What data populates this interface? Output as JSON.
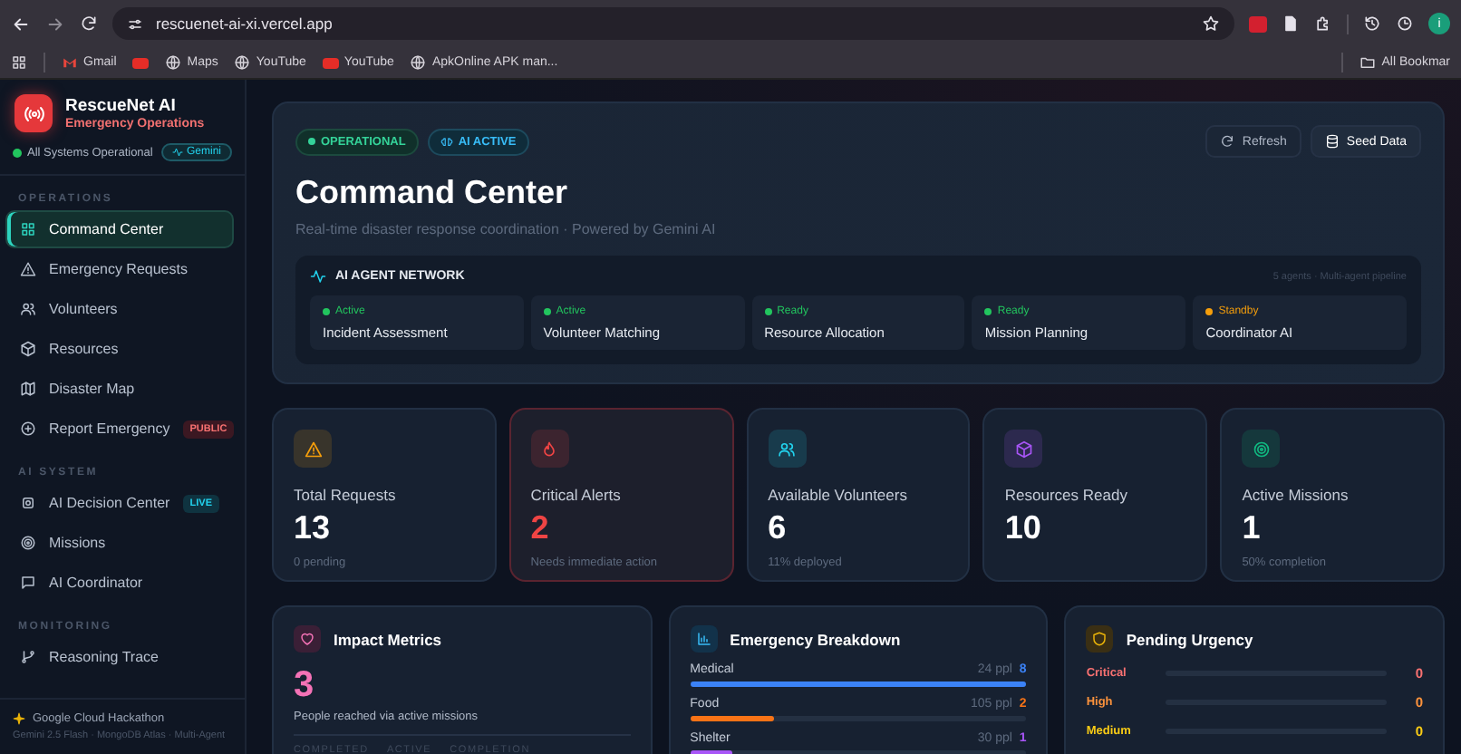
{
  "browser": {
    "url": "rescuenet-ai-xi.vercel.app",
    "profile_initial": "i",
    "bookmarks": [
      {
        "label": "Gmail",
        "kind": "gmail"
      },
      {
        "kind": "youtube"
      },
      {
        "label": "Maps",
        "kind": "globe"
      },
      {
        "label": "YouTube",
        "kind": "globe"
      },
      {
        "label": "YouTube",
        "kind": "youtube"
      },
      {
        "label": "ApkOnline APK man...",
        "kind": "globe"
      }
    ],
    "all_bookmarks": "All Bookmar"
  },
  "sidebar": {
    "app_name": "RescueNet AI",
    "subtitle": "Emergency Operations",
    "status": "All Systems Operational",
    "model_badge": "Gemini",
    "sections": [
      {
        "title": "OPERATIONS",
        "items": [
          {
            "label": "Command Center",
            "selected": true
          },
          {
            "label": "Emergency Requests",
            "selected": false
          },
          {
            "label": "Volunteers",
            "selected": false
          },
          {
            "label": "Resources",
            "selected": false
          },
          {
            "label": "Disaster Map",
            "selected": false
          },
          {
            "label": "Report Emergency",
            "selected": false,
            "badge": {
              "label": "PUBLIC",
              "kind": "danger"
            }
          }
        ]
      },
      {
        "title": "AI SYSTEM",
        "items": [
          {
            "label": "AI Decision Center",
            "selected": false,
            "badge": {
              "label": "LIVE",
              "kind": "info"
            }
          },
          {
            "label": "Missions",
            "selected": false
          },
          {
            "label": "AI Coordinator",
            "selected": false
          }
        ]
      },
      {
        "title": "MONITORING",
        "items": [
          {
            "label": "Reasoning Trace",
            "selected": false
          }
        ]
      }
    ],
    "footer": {
      "title": "Google Cloud Hackathon",
      "detail": "Gemini 2.5 Flash · MongoDB Atlas · Multi-Agent"
    }
  },
  "header": {
    "tags": [
      {
        "label": "OPERATIONAL",
        "kind": "success"
      },
      {
        "label": "AI ACTIVE",
        "kind": "info"
      }
    ],
    "buttons": [
      {
        "label": "Refresh",
        "kind": "ghost"
      },
      {
        "label": "Seed Data",
        "kind": "solid"
      }
    ],
    "title": "Command Center",
    "subtitle": "Real-time disaster response coordination · Powered by Gemini AI",
    "agent_network": {
      "title": "AI AGENT NETWORK",
      "meta": "5 agents · Multi-agent pipeline",
      "agents": [
        {
          "status": "Active",
          "name": "Incident Assessment",
          "color": "#22c55e"
        },
        {
          "status": "Active",
          "name": "Volunteer Matching",
          "color": "#22c55e"
        },
        {
          "status": "Ready",
          "name": "Resource Allocation",
          "color": "#22c55e"
        },
        {
          "status": "Ready",
          "name": "Mission Planning",
          "color": "#22c55e"
        },
        {
          "status": "Standby",
          "name": "Coordinator AI",
          "color": "#f59e0b"
        }
      ]
    }
  },
  "stats": [
    {
      "label": "Total Requests",
      "value": "13",
      "note": "0 pending",
      "color": "#f59e0b",
      "alert": false
    },
    {
      "label": "Critical Alerts",
      "value": "2",
      "note": "Needs immediate action",
      "color": "#ef4444",
      "alert": true
    },
    {
      "label": "Available Volunteers",
      "value": "6",
      "note": "11% deployed",
      "color": "#22d3ee",
      "alert": false
    },
    {
      "label": "Resources Ready",
      "value": "10",
      "color": "#a855f7",
      "alert": false
    },
    {
      "label": "Active Missions",
      "value": "1",
      "note": "50% completion",
      "color": "#10b981",
      "alert": false
    }
  ],
  "impact": {
    "title": "Impact Metrics",
    "value": "3",
    "caption": "People reached via active missions",
    "columns": [
      "COMPLETED",
      "ACTIVE",
      "COMPLETION"
    ]
  },
  "breakdown": {
    "title": "Emergency Breakdown",
    "rows": [
      {
        "label": "Medical",
        "people": "24 ppl",
        "count": "8",
        "level": 1,
        "color": "#3b82f6"
      },
      {
        "label": "Food",
        "people": "105 ppl",
        "count": "2",
        "level": 0.25,
        "color": "#f97316"
      },
      {
        "label": "Shelter",
        "people": "30 ppl",
        "count": "1",
        "level": 0.125,
        "color": "#a855f7"
      }
    ]
  },
  "urgency": {
    "title": "Pending Urgency",
    "rows": [
      {
        "label": "Critical",
        "count": "0",
        "level": 0,
        "color": "#f87171"
      },
      {
        "label": "High",
        "count": "0",
        "level": 0,
        "color": "#fb923c"
      },
      {
        "label": "Medium",
        "count": "0",
        "level": 0,
        "color": "#facc15"
      }
    ]
  }
}
